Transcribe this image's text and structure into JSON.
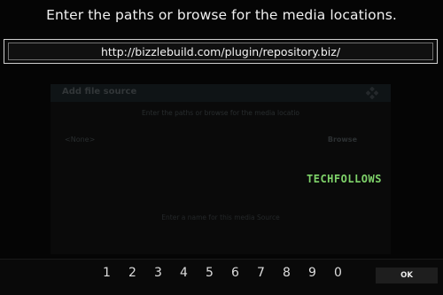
{
  "header": {
    "title": "Enter the paths or browse for the media locations."
  },
  "input": {
    "value": "http://bizzlebuild.com/plugin/repository.biz/"
  },
  "dialog": {
    "title": "Add file source",
    "hint": "Enter the paths or browse for the media locatio",
    "none_label": "<None>",
    "browse_label": "Browse",
    "footer_hint": "Enter a name for this media Source"
  },
  "watermark": {
    "text": "TECHFOLLOWS",
    "color": "#7fd36a"
  },
  "keyboard": {
    "digits": [
      "1",
      "2",
      "3",
      "4",
      "5",
      "6",
      "7",
      "8",
      "9",
      "0"
    ],
    "ok_label": "OK"
  }
}
